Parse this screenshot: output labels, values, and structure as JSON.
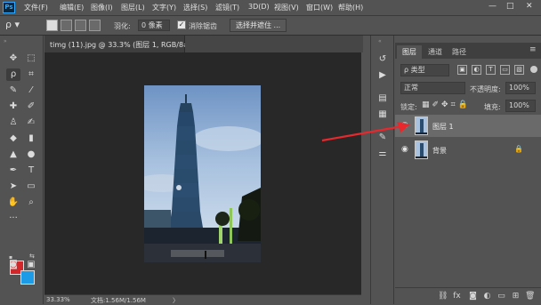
{
  "menubar": {
    "logo": "Ps",
    "items": [
      "文件(F)",
      "编辑(E)",
      "图像(I)",
      "图层(L)",
      "文字(Y)",
      "选择(S)",
      "滤镜(T)",
      "3D(D)",
      "视图(V)",
      "窗口(W)",
      "帮助(H)"
    ],
    "window_buttons": [
      "—",
      "□",
      "✕"
    ]
  },
  "options": {
    "feather_label": "羽化:",
    "feather_value": "0 像素",
    "antialias_label": "消除锯齿",
    "select_mask_button": "选择并遮住 ..."
  },
  "document": {
    "tab_title": "timg (11).jpg @ 33.3% (图层 1, RGB/8#) *",
    "tab_close": "✕",
    "zoom": "33.33%",
    "doc_size": "文档:1.56M/1.56M",
    "status_arrow": "〉"
  },
  "panel": {
    "tabs": [
      "图层",
      "通道",
      "路径"
    ],
    "filter_label": "ρ 类型",
    "blend_mode": "正常",
    "opacity_label": "不透明度:",
    "opacity_value": "100%",
    "lock_label": "锁定:",
    "fill_label": "填充:",
    "fill_value": "100%",
    "layers": [
      {
        "name": "图层 1",
        "selected": true,
        "locked": false
      },
      {
        "name": "背景",
        "selected": false,
        "locked": true
      }
    ]
  },
  "colors": {
    "foreground": "#d3262a",
    "background": "#1e9be6",
    "arrow": "#e8282c"
  },
  "icons": {
    "filter": [
      "image-filter-icon",
      "adjustment-filter-icon",
      "type-filter-icon",
      "shape-filter-icon",
      "smart-object-filter-icon"
    ],
    "footer": [
      "link-icon",
      "fx-icon",
      "mask-icon",
      "adjustment-icon",
      "group-icon",
      "new-layer-icon",
      "delete-icon"
    ]
  }
}
